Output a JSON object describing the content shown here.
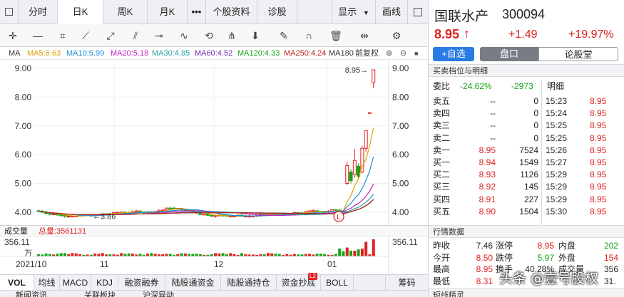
{
  "topbar": {
    "tabs": [
      "分时",
      "日K",
      "周K",
      "月K"
    ],
    "more": "•••",
    "extra_tabs": [
      "个股资料",
      "诊股"
    ],
    "display_label": "显示",
    "draw_label": "画线"
  },
  "ma_bar": {
    "label": "MA",
    "items": [
      {
        "text": "MA5:6.63",
        "color": "#e0a000"
      },
      {
        "text": "MA10:5.99",
        "color": "#1a8fd8"
      },
      {
        "text": "MA20:5.18",
        "color": "#c020c0"
      },
      {
        "text": "MA30:4.85",
        "color": "#2aa0a0"
      },
      {
        "text": "MA60:4.52",
        "color": "#6a2ab0"
      },
      {
        "text": "MA120:4.33",
        "color": "#13a313"
      },
      {
        "text": "MA250:4.24",
        "color": "#c02020"
      },
      {
        "text": "MA180",
        "color": "#333333"
      }
    ],
    "adjust_label": "前复权"
  },
  "chart_data": [
    {
      "type": "candlestick",
      "title": "",
      "y_ticks": [
        "9.00",
        "8.00",
        "7.00",
        "6.00",
        "5.00",
        "4.00"
      ],
      "ylim": [
        3.7,
        9.2
      ],
      "x_ticks": [
        "2021/10",
        "11",
        "12",
        "01"
      ],
      "annotations": {
        "high_label": "8.95",
        "low_label": "3.86",
        "marker": "L"
      },
      "candles_recent": [
        {
          "o": 5.0,
          "c": 5.62,
          "h": 5.75,
          "l": 4.95
        },
        {
          "o": 5.4,
          "c": 5.1,
          "h": 5.5,
          "l": 5.0
        },
        {
          "o": 5.3,
          "c": 5.8,
          "h": 6.2,
          "l": 5.2
        },
        {
          "o": 5.6,
          "c": 5.25,
          "h": 5.7,
          "l": 5.15
        },
        {
          "o": 5.4,
          "c": 6.22,
          "h": 6.3,
          "l": 5.35
        },
        {
          "o": 6.22,
          "c": 6.84,
          "h": 6.84,
          "l": 6.1
        },
        {
          "o": 7.46,
          "c": 7.46,
          "h": 7.46,
          "l": 7.46
        },
        {
          "o": 8.5,
          "c": 8.95,
          "h": 8.95,
          "l": 8.31
        }
      ]
    },
    {
      "type": "bar",
      "title": "成交量",
      "total_label": "总量:3561131",
      "ymax_label": "356.11",
      "unit_label": "万"
    }
  ],
  "vol_header": {
    "title": "成交量",
    "total": "总量:3561131",
    "max": "356.11",
    "unit": "万"
  },
  "bottom_tabs": [
    "VOL",
    "均线",
    "MACD",
    "KDJ",
    "融资融券",
    "陆股通资金",
    "陆股通持仓",
    "资金抄底",
    "BOLL",
    "筹码"
  ],
  "l2_badge": "L2",
  "sub_tabs": [
    "新闻资讯",
    "关联板块",
    "沪深异动"
  ],
  "quote": {
    "name": "国联水产",
    "code": "300094",
    "price": "8.95",
    "arrow": "↑",
    "change": "+1.49",
    "change_pct": "+19.97%",
    "add_watch": "+自选",
    "tab_pankou": "盘口",
    "tab_lun": "论股堂"
  },
  "orderbook": {
    "title": "买卖档位与明细",
    "weibi_label": "委比",
    "weibi_pct": "-24.62%",
    "weibi_val": "-2973",
    "detail_label": "明细",
    "rows": [
      {
        "label": "卖五",
        "price": "--",
        "vol": "0",
        "time": "15:23",
        "tprice": "8.95"
      },
      {
        "label": "卖四",
        "price": "--",
        "vol": "0",
        "time": "15:24",
        "tprice": "8.95"
      },
      {
        "label": "卖三",
        "price": "--",
        "vol": "0",
        "time": "15:25",
        "tprice": "8.95"
      },
      {
        "label": "卖二",
        "price": "--",
        "vol": "0",
        "time": "15:25",
        "tprice": "8.95"
      },
      {
        "label": "卖一",
        "price": "8.95",
        "vol": "7524",
        "time": "15:26",
        "tprice": "8.95"
      },
      {
        "label": "买一",
        "price": "8.94",
        "vol": "1549",
        "time": "15:27",
        "tprice": "8.95"
      },
      {
        "label": "买二",
        "price": "8.93",
        "vol": "1126",
        "time": "15:29",
        "tprice": "8.95"
      },
      {
        "label": "买三",
        "price": "8.92",
        "vol": "145",
        "time": "15:29",
        "tprice": "8.95"
      },
      {
        "label": "买四",
        "price": "8.91",
        "vol": "227",
        "time": "15:29",
        "tprice": "8.95"
      },
      {
        "label": "买五",
        "price": "8.90",
        "vol": "1504",
        "time": "15:30",
        "tprice": "8.95"
      }
    ]
  },
  "market": {
    "title": "行情数据",
    "rows": [
      {
        "l1": "昨收",
        "v1": "7.46",
        "l2": "涨停",
        "v2": "8.95",
        "l3": "内盘",
        "v3": "202"
      },
      {
        "l1": "今开",
        "v1": "8.50",
        "l2": "跌停",
        "v2": "5.97",
        "l3": "外盘",
        "v3": "154"
      },
      {
        "l1": "最高",
        "v1": "8.95",
        "l2": "换手",
        "v2": "40.28%",
        "l3": "成交量",
        "v3": "356"
      },
      {
        "l1": "最低",
        "v1": "8.31",
        "l2": "",
        "v2": "",
        "l3": "",
        "v3": "31."
      }
    ]
  },
  "short_title": "短线精灵",
  "watermark": "头条 @壹号股权"
}
